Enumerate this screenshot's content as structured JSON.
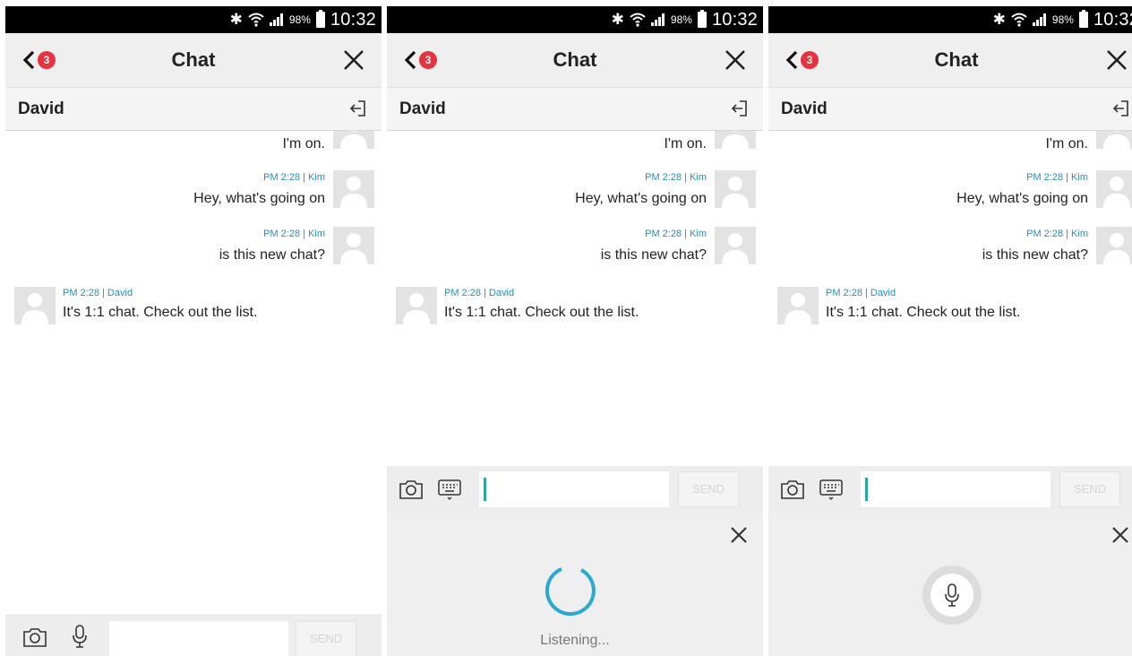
{
  "status_bar": {
    "battery_pct": "98%",
    "time": "10:32"
  },
  "header": {
    "unread_count": "3",
    "title": "Chat"
  },
  "conversation": {
    "partner_name": "David"
  },
  "messages": [
    {
      "side": "right",
      "meta": "",
      "text": "I'm on."
    },
    {
      "side": "right",
      "meta": "PM 2:28 | Kim",
      "text": "Hey, what's going on"
    },
    {
      "side": "right",
      "meta": "PM 2:28 | Kim",
      "text": "is this new chat?"
    },
    {
      "side": "left",
      "meta": "PM 2:28 | David",
      "text": "It's 1:1 chat. Check out the list."
    }
  ],
  "input": {
    "value": "",
    "send_label": "SEND"
  },
  "voice": {
    "listening_label": "Listening..."
  },
  "colors": {
    "badge": "#e5343f",
    "meta_text": "#2a8db8",
    "spinner": "#29a8d1",
    "cursor": "#2aa7a0"
  },
  "icons": {
    "back": "chevron-left-icon",
    "close": "close-icon",
    "leave": "leave-chat-icon",
    "camera": "camera-icon",
    "microphone": "microphone-icon",
    "keyboard": "keyboard-icon"
  }
}
